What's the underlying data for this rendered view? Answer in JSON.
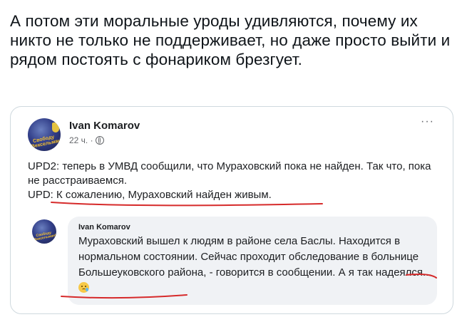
{
  "tweet": {
    "text": "А потом эти моральные уроды удивляются, почему их никто не только не поддерживает, но даже просто выйти и рядом постоять с фонариком брезгует."
  },
  "fb_post": {
    "author": "Ivan Komarov",
    "time": "22 ч. ·",
    "privacy_icon": "globe-icon",
    "more_icon": "more-options-icon",
    "more_glyph": "···",
    "avatar_text": "Свободу Вексельман!",
    "line1": "UPD2: теперь в УМВД сообщили, что Мураховский пока не найден. Так что, пока не расстраиваемся.",
    "line2_prefix": "UPD: ",
    "line2_highlight": "К сожалению, Мураховский найден живым."
  },
  "comment": {
    "author": "Ivan Komarov",
    "text": "Мураховский вышел к людям в районе села Баслы. Находится в нормальном состоянии. Сейчас проходит обследование в больнице Большеуковского района, - говорится в сообщении. ",
    "highlight": "А я так надеялся...",
    "emoji": "crying-face-emoji"
  },
  "colors": {
    "annotation_red": "#d62a2a",
    "comment_bg": "#f0f2f5",
    "meta_gray": "#65676b"
  }
}
